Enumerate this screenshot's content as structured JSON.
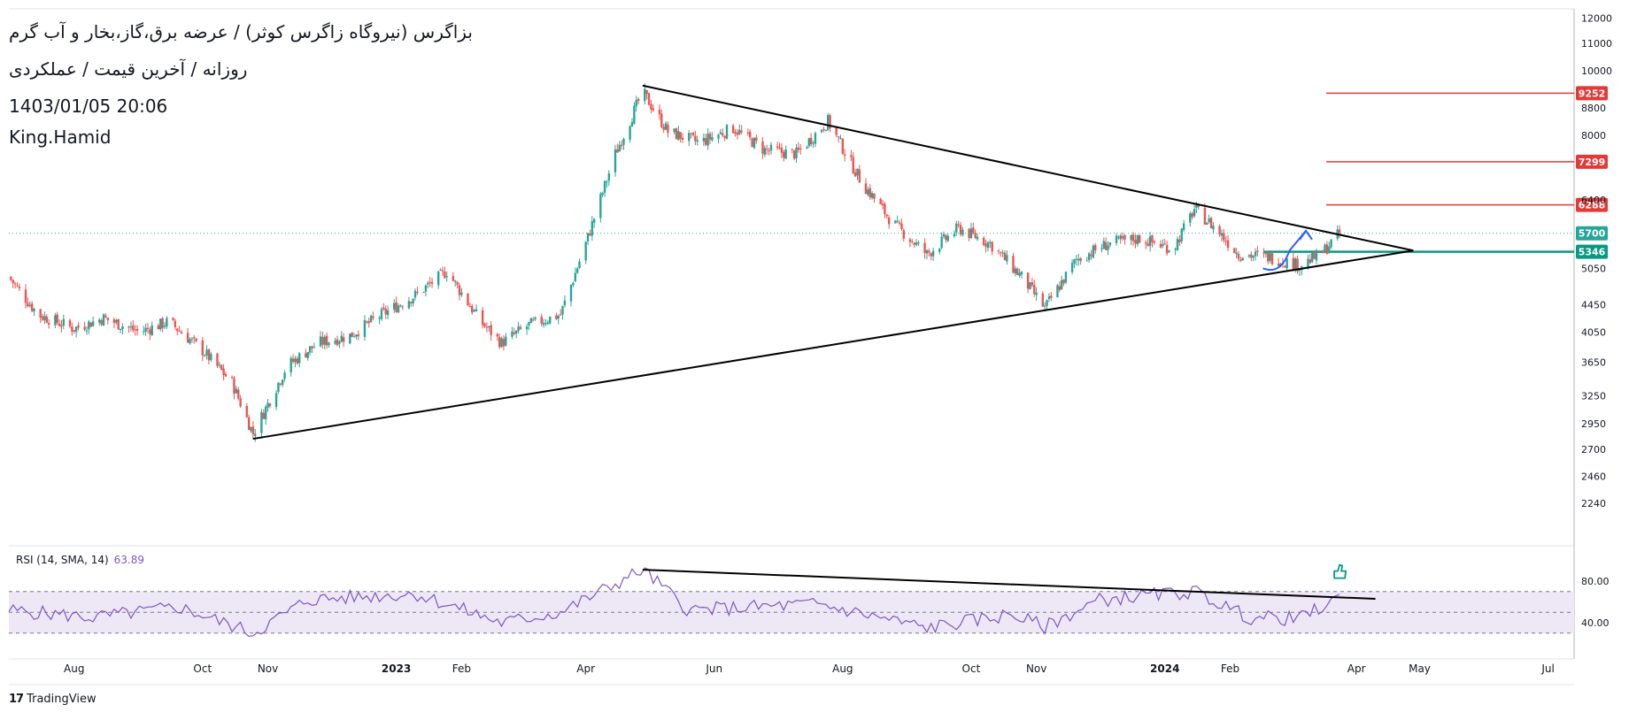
{
  "header": {
    "title": "بزاگرس (نیروگاه زاگرس کوثر) / عرضه برق،گاز،بخار و آب گرم",
    "subtitle": "روزانه / آخرین قیمت / عملکردی",
    "datetime": "1403/01/05 20:06",
    "author": "King.Hamid"
  },
  "rsi": {
    "label": "RSI (14, SMA, 14)",
    "value": "63.89"
  },
  "brand": {
    "name": "TradingView",
    "logo_text": "17"
  },
  "colors": {
    "up": "#26a69a",
    "down": "#ef5350",
    "resistance": "#e53935",
    "support": "#089981",
    "rsi_line": "#7e57c2",
    "rsi_band": "#ede7f6",
    "trendline": "#000000",
    "arrow": "#2962ff"
  },
  "chart_data": {
    "type": "candlestick",
    "price_axis": {
      "scale": "log",
      "ticks": [
        12000,
        11000,
        10000,
        8800,
        8000,
        6400,
        5050,
        4450,
        4050,
        3650,
        3250,
        2950,
        2700,
        2460,
        2240
      ]
    },
    "x_axis": {
      "ticks": [
        "Aug",
        "Oct",
        "Nov",
        "2023",
        "Feb",
        "Apr",
        "Jun",
        "Aug",
        "Oct",
        "Nov",
        "2024",
        "Feb",
        "Apr",
        "May",
        "Jul"
      ],
      "bold_ticks": [
        "2023",
        "2024"
      ]
    },
    "levels": [
      {
        "value": 9252,
        "label": "9252",
        "kind": "resistance"
      },
      {
        "value": 7299,
        "label": "7299",
        "kind": "resistance"
      },
      {
        "value": 6288,
        "label": "6288",
        "kind": "resistance"
      },
      {
        "value": 5700,
        "label": "5700",
        "kind": "last_price"
      },
      {
        "value": 5346,
        "label": "5346",
        "kind": "support"
      }
    ],
    "triangle": {
      "upper_trendline": [
        [
          "2023-04-28",
          9500
        ],
        [
          "2024-04-28",
          5370
        ]
      ],
      "lower_trendline": [
        [
          "2022-10-25",
          2800
        ],
        [
          "2024-04-28",
          5370
        ]
      ]
    },
    "close_series": [
      [
        "2022-07-01",
        4900
      ],
      [
        "2022-07-15",
        4300
      ],
      [
        "2022-08-01",
        4100
      ],
      [
        "2022-08-15",
        4250
      ],
      [
        "2022-09-01",
        4050
      ],
      [
        "2022-09-15",
        4200
      ],
      [
        "2022-10-01",
        3800
      ],
      [
        "2022-10-15",
        3400
      ],
      [
        "2022-10-25",
        2850
      ],
      [
        "2022-11-10",
        3600
      ],
      [
        "2022-11-25",
        3900
      ],
      [
        "2022-12-10",
        4000
      ],
      [
        "2022-12-25",
        4300
      ],
      [
        "2023-01-10",
        4600
      ],
      [
        "2023-01-25",
        5000
      ],
      [
        "2023-02-10",
        4200
      ],
      [
        "2023-02-20",
        3900
      ],
      [
        "2023-03-05",
        4150
      ],
      [
        "2023-03-20",
        4300
      ],
      [
        "2023-04-01",
        5500
      ],
      [
        "2023-04-15",
        7500
      ],
      [
        "2023-04-28",
        9300
      ],
      [
        "2023-05-10",
        8100
      ],
      [
        "2023-05-25",
        7800
      ],
      [
        "2023-06-10",
        8200
      ],
      [
        "2023-06-25",
        7600
      ],
      [
        "2023-07-10",
        7500
      ],
      [
        "2023-07-25",
        8400
      ],
      [
        "2023-08-10",
        6800
      ],
      [
        "2023-08-25",
        5900
      ],
      [
        "2023-09-10",
        5300
      ],
      [
        "2023-09-25",
        5800
      ],
      [
        "2023-10-10",
        5500
      ],
      [
        "2023-10-25",
        4900
      ],
      [
        "2023-11-05",
        4400
      ],
      [
        "2023-11-20",
        5200
      ],
      [
        "2023-12-05",
        5500
      ],
      [
        "2023-12-20",
        5600
      ],
      [
        "2024-01-05",
        5400
      ],
      [
        "2024-01-15",
        6200
      ],
      [
        "2024-01-25",
        5800
      ],
      [
        "2024-02-05",
        5300
      ],
      [
        "2024-02-20",
        5250
      ],
      [
        "2024-03-05",
        5100
      ],
      [
        "2024-03-15",
        5300
      ],
      [
        "2024-03-24",
        5700
      ]
    ],
    "rsi_panel": {
      "ticks": [
        80.0,
        40.0
      ],
      "bands": [
        70,
        50,
        30
      ],
      "trendline": [
        [
          "2023-04-28",
          91
        ],
        [
          "2024-04-10",
          63
        ]
      ],
      "last": 63.89
    }
  }
}
